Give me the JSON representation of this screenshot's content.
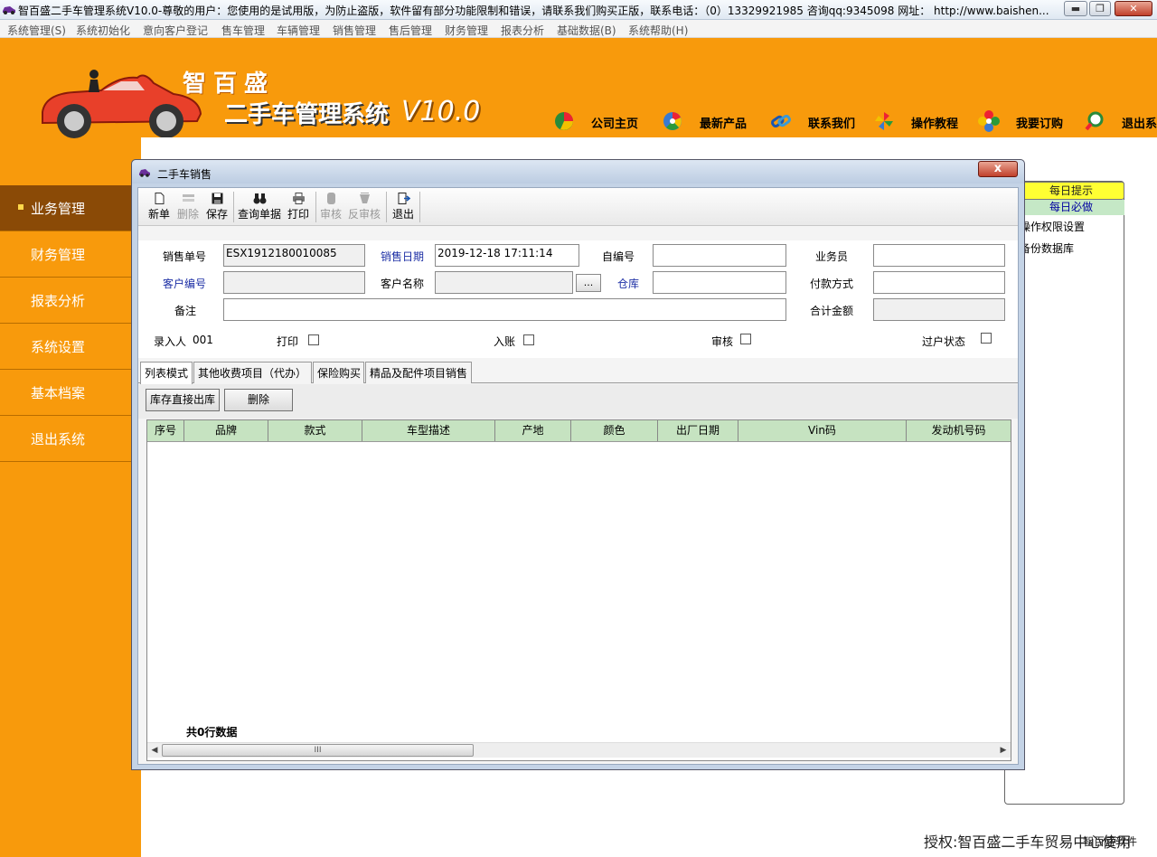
{
  "window": {
    "title": "智百盛二手车管理系统V10.0-尊敬的用户：您使用的是试用版，为防止盗版，软件留有部分功能限制和错误，请联系我们购买正版，联系电话：（0）13329921985  咨询qq:9345098   网址： http://www.baishen..."
  },
  "menubar": {
    "items": [
      "系统管理(S)",
      "系统初始化",
      "意向客户登记",
      "售车管理",
      "车辆管理",
      "销售管理",
      "售后管理",
      "财务管理",
      "报表分析",
      "基础数据(B)",
      "系统帮助(H)"
    ]
  },
  "header": {
    "logo_line1": "智百盛",
    "logo_line2": "二手车管理系统",
    "logo_version": "V10.0",
    "nav": [
      {
        "label": "公司主页",
        "icon": "pie-chart-icon"
      },
      {
        "label": "最新产品",
        "icon": "color-wheel-icon"
      },
      {
        "label": "联系我们",
        "icon": "chain-link-icon"
      },
      {
        "label": "操作教程",
        "icon": "pinwheel-icon"
      },
      {
        "label": "我要订购",
        "icon": "flower-icon"
      },
      {
        "label": "退出系统",
        "icon": "magnifier-icon"
      }
    ]
  },
  "sidebar": {
    "items": [
      "业务管理",
      "财务管理",
      "报表分析",
      "系统设置",
      "基本档案",
      "退出系统"
    ],
    "active_index": 0
  },
  "tips": {
    "daily": "每日提示",
    "must": "每日必做",
    "line1": "操作权限设置",
    "line2": "备份数据库"
  },
  "copyright": {
    "main": "授权:智百盛二手车贸易中心使用",
    "overlay": "智百盛软件"
  },
  "dialog": {
    "title": "二手车销售",
    "close": "x",
    "toolbar": [
      {
        "label": "新单",
        "icon": "new-doc-icon",
        "enabled": true
      },
      {
        "label": "删除",
        "icon": "delete-icon",
        "enabled": false
      },
      {
        "label": "保存",
        "icon": "floppy-disk-icon",
        "enabled": true
      },
      {
        "label": "查询单据",
        "icon": "binoculars-icon",
        "enabled": true
      },
      {
        "label": "打印",
        "icon": "printer-icon",
        "enabled": true
      },
      {
        "label": "审核",
        "icon": "approve-icon",
        "enabled": false
      },
      {
        "label": "反审核",
        "icon": "unapprove-icon",
        "enabled": false
      },
      {
        "label": "退出",
        "icon": "exit-door-icon",
        "enabled": true
      }
    ],
    "form": {
      "sale_no_label": "销售单号",
      "sale_no": "ESX1912180010085",
      "sale_date_label": "销售日期",
      "sale_date": "2019-12-18 17:11:14",
      "own_no_label": "自编号",
      "own_no": "",
      "salesman_label": "业务员",
      "salesman": "",
      "customer_no_label": "客户编号",
      "customer_no": "",
      "customer_name_label": "客户名称",
      "customer_name": "",
      "lookup_button": "...",
      "warehouse_label": "仓库",
      "warehouse": "",
      "payment_label": "付款方式",
      "payment": "",
      "remark_label": "备注",
      "remark": "",
      "total_label": "合计金额",
      "total": "",
      "entered_by_label": "录入人",
      "entered_by": "001",
      "print_label": "打印",
      "posted_label": "入账",
      "approved_label": "审核",
      "transfer_label": "过户状态"
    },
    "tabs": [
      "列表模式",
      "其他收费项目（代办）",
      "保险购买",
      "精品及配件项目销售"
    ],
    "active_tab": 0,
    "panel_buttons": [
      "库存直接出库",
      "删除"
    ],
    "grid": {
      "columns": [
        "序号",
        "品牌",
        "款式",
        "车型描述",
        "产地",
        "颜色",
        "出厂日期",
        "Vin码",
        "发动机号码"
      ],
      "rows": [],
      "row_count_text": "共0行数据",
      "scroll_thumb": "III"
    }
  }
}
